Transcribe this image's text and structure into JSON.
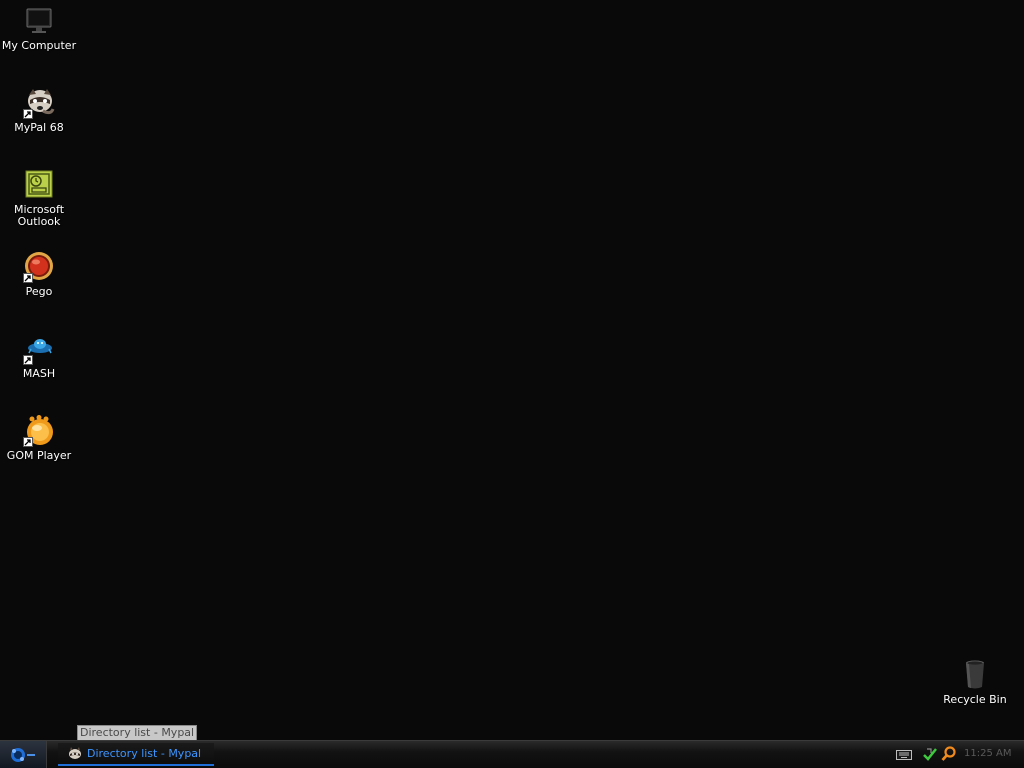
{
  "desktop": {
    "icons": [
      {
        "label": "My Computer",
        "icon": "monitor-icon",
        "shortcut": false
      },
      {
        "label": "MyPal 68",
        "icon": "mypal-raccoon-icon",
        "shortcut": true
      },
      {
        "label": "Microsoft\nOutlook",
        "icon": "outlook-icon",
        "shortcut": false
      },
      {
        "label": "Pego",
        "icon": "pego-red-orb-icon",
        "shortcut": true
      },
      {
        "label": "MASH",
        "icon": "mash-icon",
        "shortcut": true
      },
      {
        "label": "GOM Player",
        "icon": "gom-player-icon",
        "shortcut": true
      },
      {
        "label": "Recycle Bin",
        "icon": "recycle-bin-icon",
        "shortcut": false
      }
    ]
  },
  "tooltip": {
    "text": "Directory list - Mypal"
  },
  "taskbar": {
    "start_icon": "start-orb-icon",
    "tasks": [
      {
        "label": "Directory list - Mypal",
        "icon": "mypal-raccoon-icon",
        "active": true
      }
    ],
    "tray": {
      "icons": [
        "keyboard-icon",
        "green-arrow-icon",
        "search-icon"
      ],
      "clock": "11:25 AM"
    },
    "accent_color": "#1f6dd6"
  }
}
